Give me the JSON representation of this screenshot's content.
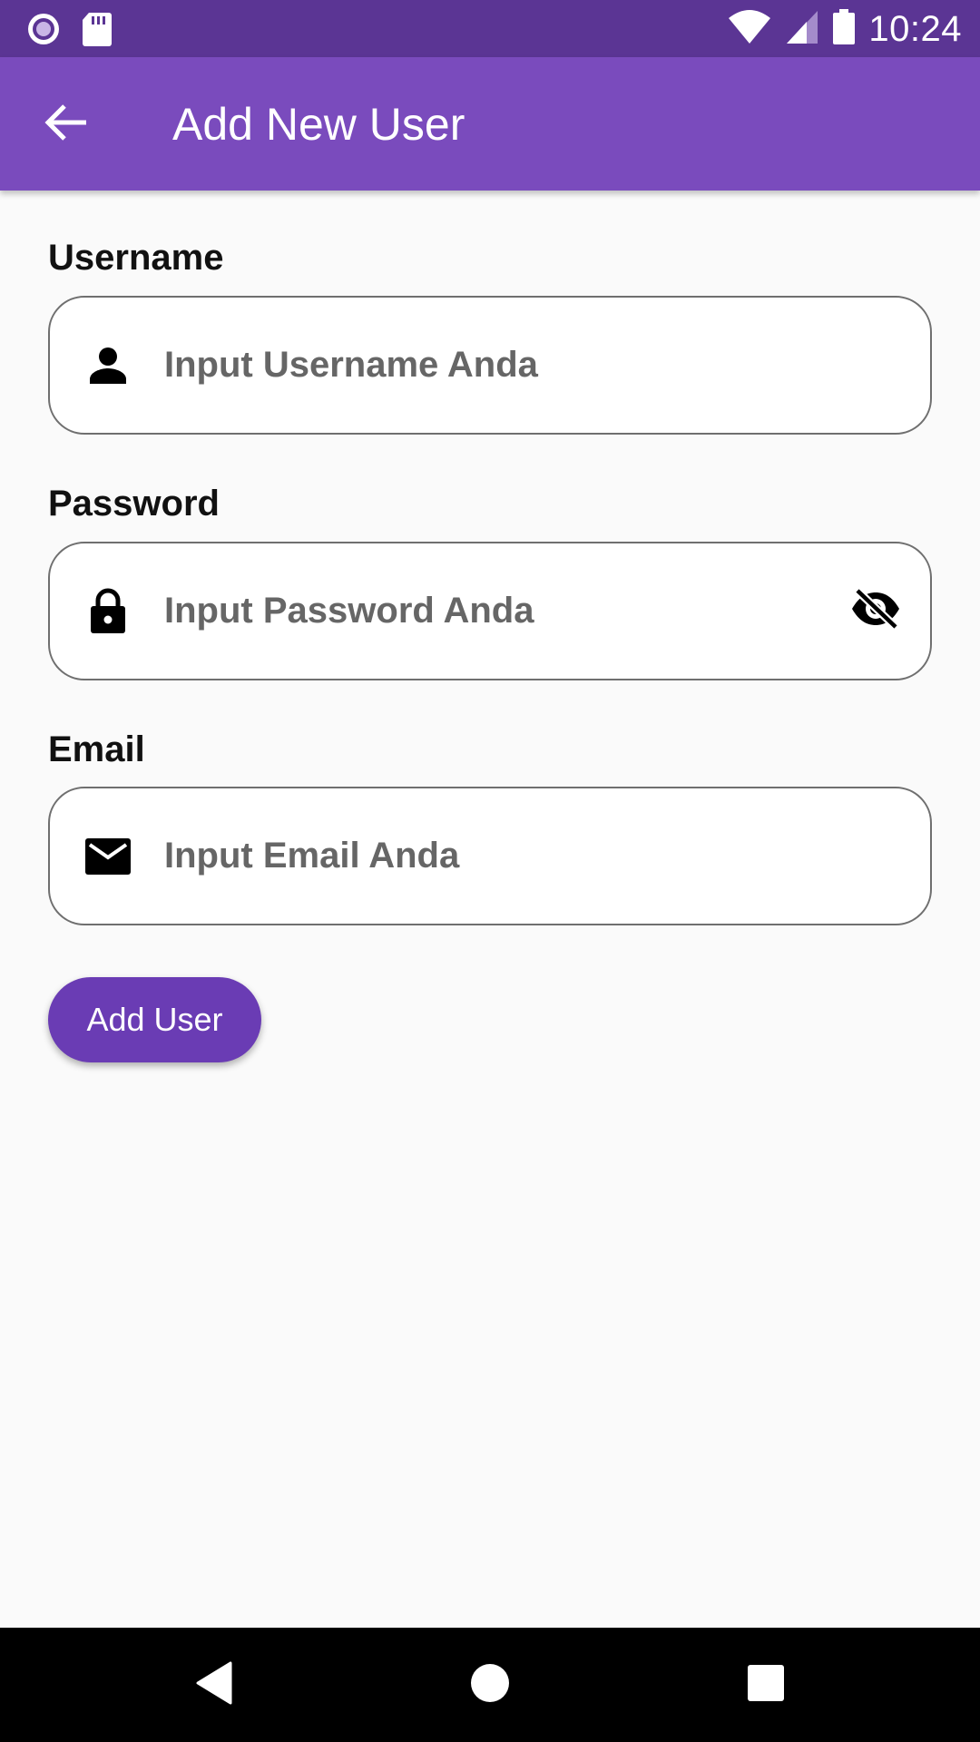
{
  "status_bar": {
    "time": "10:24",
    "icons": [
      "record-icon",
      "sd-card-icon",
      "wifi-icon",
      "signal-icon",
      "battery-icon"
    ]
  },
  "app_bar": {
    "title": "Add New User",
    "back_icon": "arrow-back-icon",
    "background": "#7a4bbd"
  },
  "form": {
    "username": {
      "label": "Username",
      "placeholder": "Input Username Anda",
      "value": "",
      "icon": "person-icon"
    },
    "password": {
      "label": "Password",
      "placeholder": "Input Password Anda",
      "value": "",
      "icon": "lock-icon",
      "toggle_icon": "visibility-off-icon"
    },
    "email": {
      "label": "Email",
      "placeholder": "Input Email Anda",
      "value": "",
      "icon": "mail-icon"
    },
    "submit_label": "Add User"
  },
  "nav_bar": {
    "icons": [
      "back-triangle-icon",
      "home-circle-icon",
      "recents-square-icon"
    ]
  },
  "colors": {
    "status_bar": "#5b3594",
    "primary": "#7a4bbd",
    "button": "#6a3cb4"
  }
}
